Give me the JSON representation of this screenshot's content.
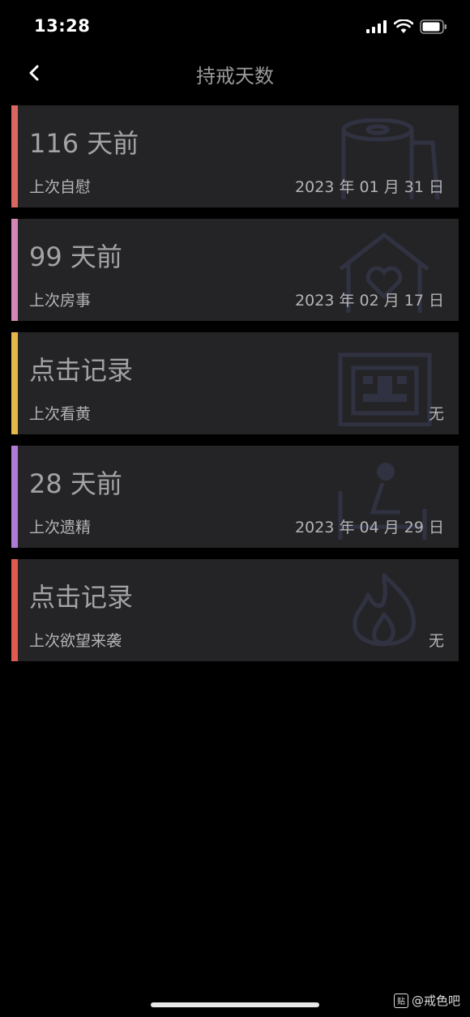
{
  "status_bar": {
    "time": "13:28"
  },
  "nav": {
    "title": "持戒天数"
  },
  "cards": [
    {
      "main": "116 天前",
      "label": "上次自慰",
      "date": "2023 年 01 月 31 日",
      "accent": "#d9675f",
      "icon": "toilet-paper-icon"
    },
    {
      "main": "99 天前",
      "label": "上次房事",
      "date": "2023 年 02 月 17 日",
      "accent": "#d487b6",
      "icon": "house-heart-icon"
    },
    {
      "main": "点击记录",
      "label": "上次看黄",
      "date": "无",
      "accent": "#e6b84a",
      "icon": "adult-sign-icon"
    },
    {
      "main": "28 天前",
      "label": "上次遗精",
      "date": "2023 年 04 月 29 日",
      "accent": "#b07ad6",
      "icon": "person-bed-icon"
    },
    {
      "main": "点击记录",
      "label": "上次欲望来袭",
      "date": "无",
      "accent": "#e05a52",
      "icon": "flame-icon"
    }
  ],
  "watermark": {
    "text": "@戒色吧",
    "badge": "贴"
  }
}
